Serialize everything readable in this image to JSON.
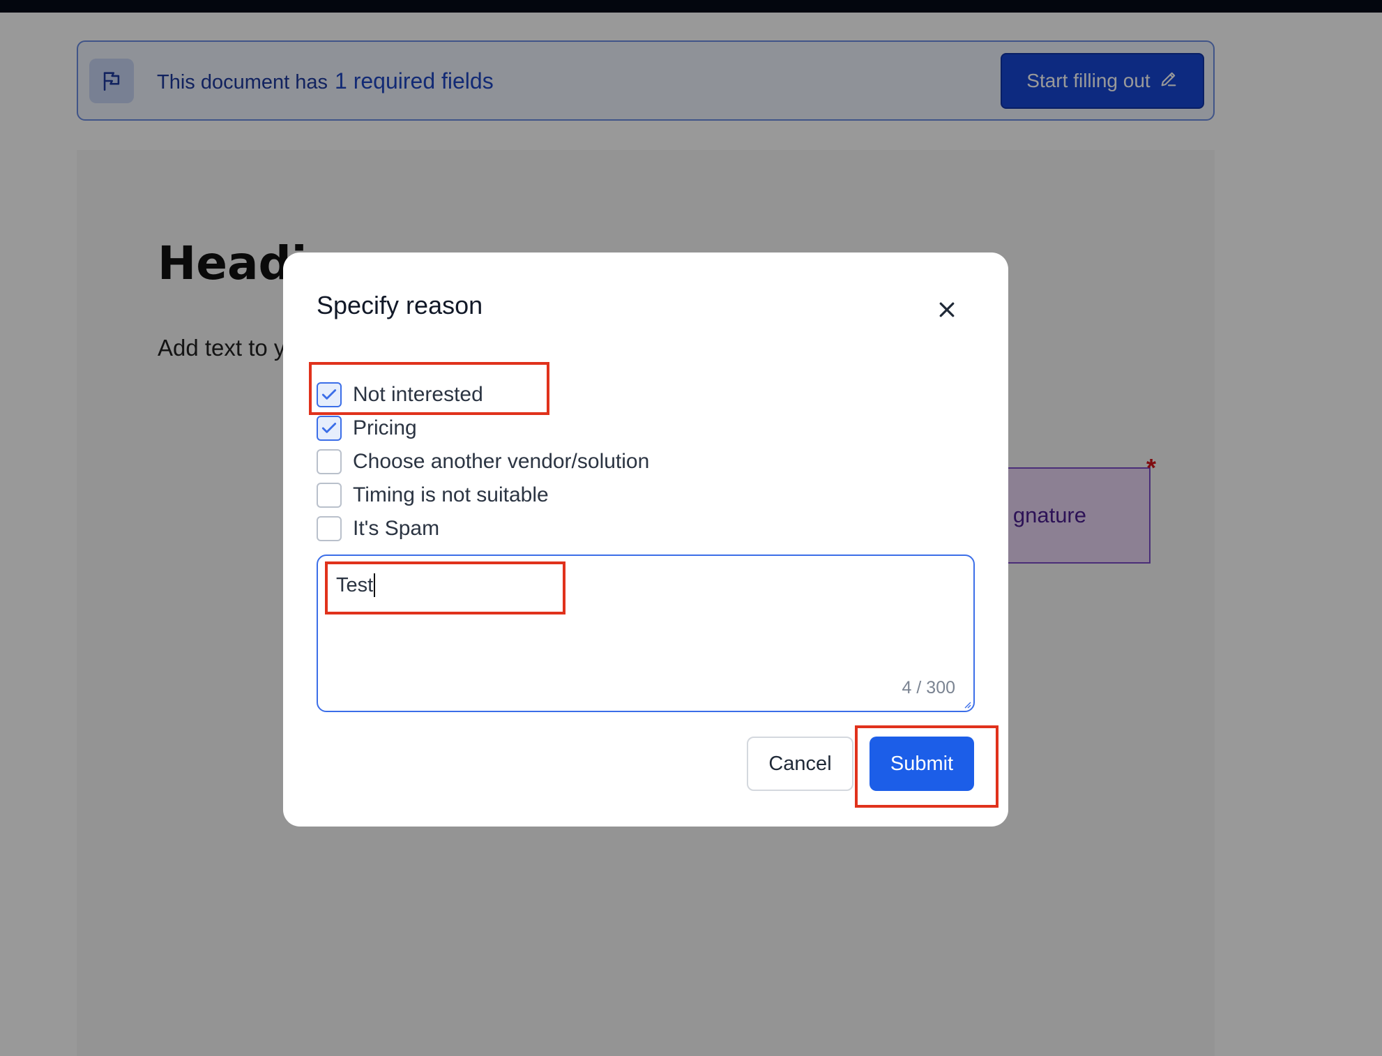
{
  "notice": {
    "text": "This document has",
    "count": "1 required fields",
    "start_label": "Start filling out"
  },
  "document": {
    "heading": "Headi",
    "body_text": "Add text to y",
    "signature_label_fragment": "g",
    "signature_fragment": "gnature",
    "required_mark": "*"
  },
  "modal": {
    "title": "Specify reason",
    "options": [
      {
        "label": "Not interested",
        "checked": true
      },
      {
        "label": "Pricing",
        "checked": true
      },
      {
        "label": "Choose another vendor/solution",
        "checked": false
      },
      {
        "label": "Timing is not suitable",
        "checked": false
      },
      {
        "label": "It's Spam",
        "checked": false
      }
    ],
    "comment_value": "Test",
    "char_count": "4 / 300",
    "cancel_label": "Cancel",
    "submit_label": "Submit"
  },
  "colors": {
    "accent": "#1c5ee8",
    "highlight": "#e0321c",
    "required": "#d4151b"
  }
}
